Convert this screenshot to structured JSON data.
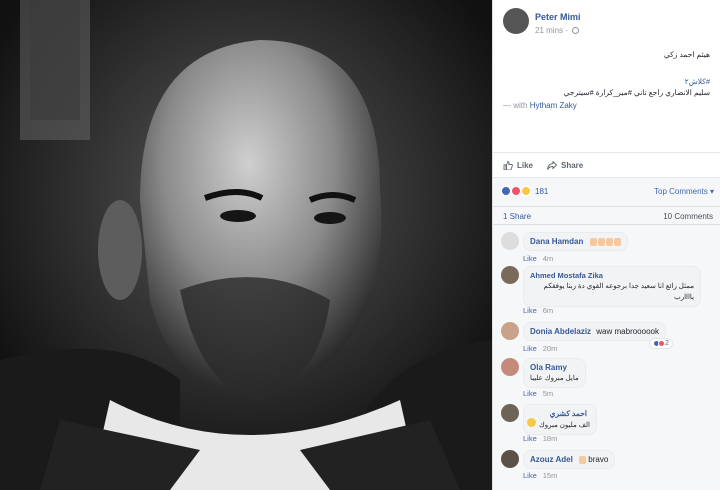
{
  "post": {
    "author": "Peter Mimi",
    "time": "21 mins",
    "line1": "هيثم احمد زكي",
    "tags": "#كلاش٢",
    "line3": "سليم الانصاري راجع تاني #مير_كرارة #سيترجي",
    "with_prefix": "— with",
    "with_name": "Hytham Zaky"
  },
  "actions": {
    "like": "Like",
    "share": "Share"
  },
  "reactions": {
    "count": "181",
    "top_comments": "Top Comments"
  },
  "stats": {
    "shares": "1 Share",
    "comments": "10 Comments"
  },
  "comments": [
    {
      "name": "Dana Hamdan",
      "text": "",
      "meta": "Like",
      "time": "4m"
    },
    {
      "name": "Ahmed Mostafa Zika",
      "text": "ممثل رائع انا سعيد جدا برجوعه القوي دة ربنا يوفقكم ياااارب",
      "meta": "Like",
      "time": "6m"
    },
    {
      "name": "Donia Abdelaziz",
      "text": "waw mabroooook",
      "meta": "Like",
      "time": "20m",
      "badge": "2"
    },
    {
      "name": "Ola Ramy",
      "text": "مايل مبروك عليبا",
      "meta": "Like",
      "time": "5m"
    },
    {
      "name": "احمد كشري",
      "text": "الف مليون مبروك",
      "meta": "Like",
      "time": "18m"
    },
    {
      "name": "Azouz Adel",
      "text": "bravo",
      "meta": "Like",
      "time": "15m"
    }
  ],
  "colors": {
    "link": "#365899",
    "accent": "#4267b2",
    "panel_bg": "#f6f7f9"
  },
  "icons": [
    "globe-icon",
    "like-icon",
    "share-icon",
    "like-reaction-icon",
    "love-reaction-icon",
    "wow-reaction-icon",
    "chevron-down-icon",
    "clap-emoji-icon",
    "heart-eyes-emoji-icon"
  ]
}
